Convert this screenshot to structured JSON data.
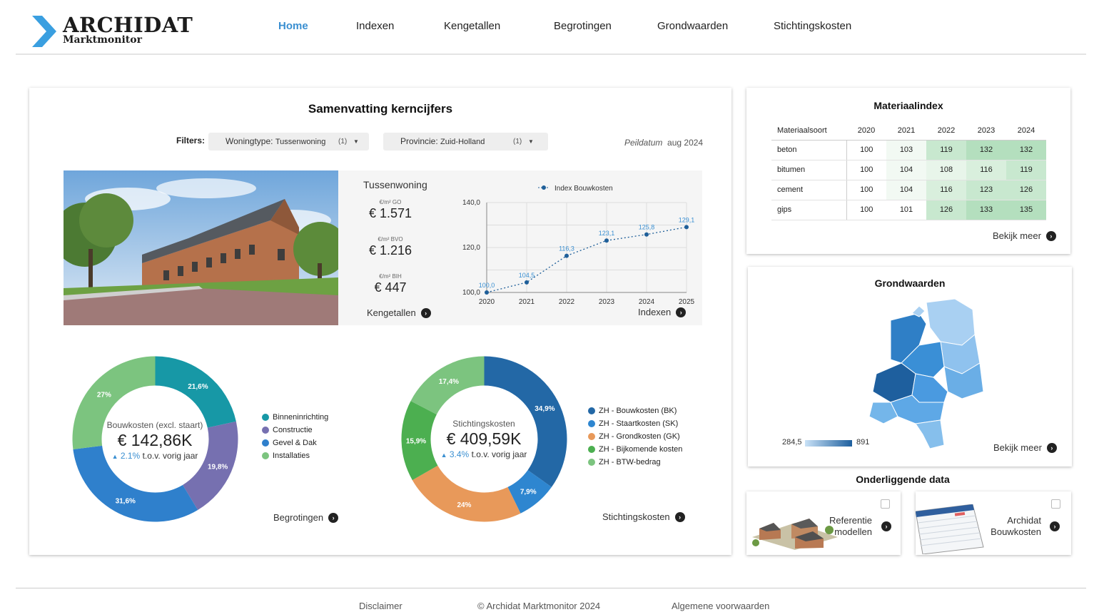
{
  "header": {
    "logo_title": "ARCHIDAT",
    "logo_sub": "Marktmonitor",
    "nav": [
      {
        "label": "Home",
        "active": true
      },
      {
        "label": "Indexen"
      },
      {
        "label": "Kengetallen"
      },
      {
        "label": "Begrotingen"
      },
      {
        "label": "Grondwaarden"
      },
      {
        "label": "Stichtingskosten"
      }
    ]
  },
  "summary": {
    "title": "Samenvatting kerncijfers",
    "filters_label": "Filters:",
    "filter_woningtype": {
      "name": "Woningtype",
      "value": "Tussenwoning",
      "count": "(1)"
    },
    "filter_provincie": {
      "name": "Provincie",
      "value": "Zuid-Holland",
      "count": "(1)"
    },
    "peildatum_label": "Peildatum",
    "peildatum_value": "aug 2024",
    "kpi": {
      "type": "Tussenwoning",
      "items": [
        {
          "label": "€/m² GO",
          "value": "€ 1.571"
        },
        {
          "label": "€/m² BVO",
          "value": "€ 1.216"
        },
        {
          "label": "€/m² BIH",
          "value": "€ 447"
        }
      ],
      "link_kengetallen": "Kengetallen",
      "link_indexen": "Indexen"
    },
    "bouwkosten": {
      "title": "Bouwkosten (excl. staart)",
      "value": "€ 142,86K",
      "change_pct": "2.1%",
      "change_text": "t.o.v. vorig jaar",
      "link": "Begrotingen"
    },
    "stichtingskosten": {
      "title": "Stichtingskosten",
      "value": "€ 409,59K",
      "change_pct": "3.4%",
      "change_text": "t.o.v. vorig jaar",
      "link": "Stichtingskosten"
    }
  },
  "chart_data": [
    {
      "type": "line",
      "title": "",
      "legend": "Index Bouwkosten",
      "x": [
        "2020",
        "2021",
        "2022",
        "2023",
        "2024",
        "2025"
      ],
      "series": [
        {
          "name": "Index Bouwkosten",
          "values": [
            100.0,
            104.5,
            116.3,
            123.1,
            125.8,
            129.1
          ]
        }
      ],
      "point_labels": [
        "100,0",
        "104,5",
        "116,3",
        "123,1",
        "125,8",
        "129,1"
      ],
      "y_ticks": [
        "100,0",
        "120,0",
        "140,0"
      ],
      "ylim": [
        100,
        140
      ],
      "grid": true,
      "legend_position": "top",
      "color": "#1f5f99"
    },
    {
      "type": "pie",
      "title": "Bouwkosten (excl. staart)",
      "categories": [
        "Binneninrichting",
        "Constructie",
        "Gevel & Dak",
        "Installaties"
      ],
      "values": [
        21.6,
        19.8,
        31.6,
        27
      ],
      "labels": [
        "21,6%",
        "19,8%",
        "31,6%",
        "27%"
      ],
      "colors": [
        "#1798a6",
        "#7670b0",
        "#2f80cc",
        "#7cc47f"
      ],
      "legend_position": "right"
    },
    {
      "type": "pie",
      "title": "Stichtingskosten",
      "categories": [
        "ZH - Bouwkosten (BK)",
        "ZH - Staartkosten (SK)",
        "ZH - Grondkosten (GK)",
        "ZH - Bijkomende kosten",
        "ZH - BTW-bedrag"
      ],
      "values": [
        34.9,
        7.9,
        24,
        15.9,
        17.4
      ],
      "labels": [
        "34,9%",
        "7,9%",
        "24%",
        "15,9%",
        "17,4%"
      ],
      "colors": [
        "#2368a6",
        "#2e86d0",
        "#e8995a",
        "#4caf50",
        "#7cc47f"
      ],
      "legend_position": "right"
    },
    {
      "type": "table",
      "title": "Materiaalindex",
      "columns": [
        "Materiaalsoort",
        "2020",
        "2021",
        "2022",
        "2023",
        "2024"
      ],
      "rows": [
        [
          "beton",
          100,
          103,
          119,
          132,
          132
        ],
        [
          "bitumen",
          100,
          104,
          108,
          116,
          119
        ],
        [
          "cement",
          100,
          104,
          116,
          123,
          126
        ],
        [
          "gips",
          100,
          101,
          126,
          133,
          135
        ]
      ]
    }
  ],
  "materiaal": {
    "title": "Materiaalindex",
    "link": "Bekijk meer"
  },
  "grond": {
    "title": "Grondwaarden",
    "legend_min": "284,5",
    "legend_max": "891",
    "link": "Bekijk meer"
  },
  "data": {
    "title": "Onderliggende data",
    "ref_line1": "Referentie",
    "ref_line2": "modellen",
    "arch_line1": "Archidat",
    "arch_line2": "Bouwkosten"
  },
  "footer": {
    "disclaimer": "Disclaimer",
    "copyright": "© Archidat Marktmonitor 2024",
    "voorwaarden": "Algemene voorwaarden"
  }
}
